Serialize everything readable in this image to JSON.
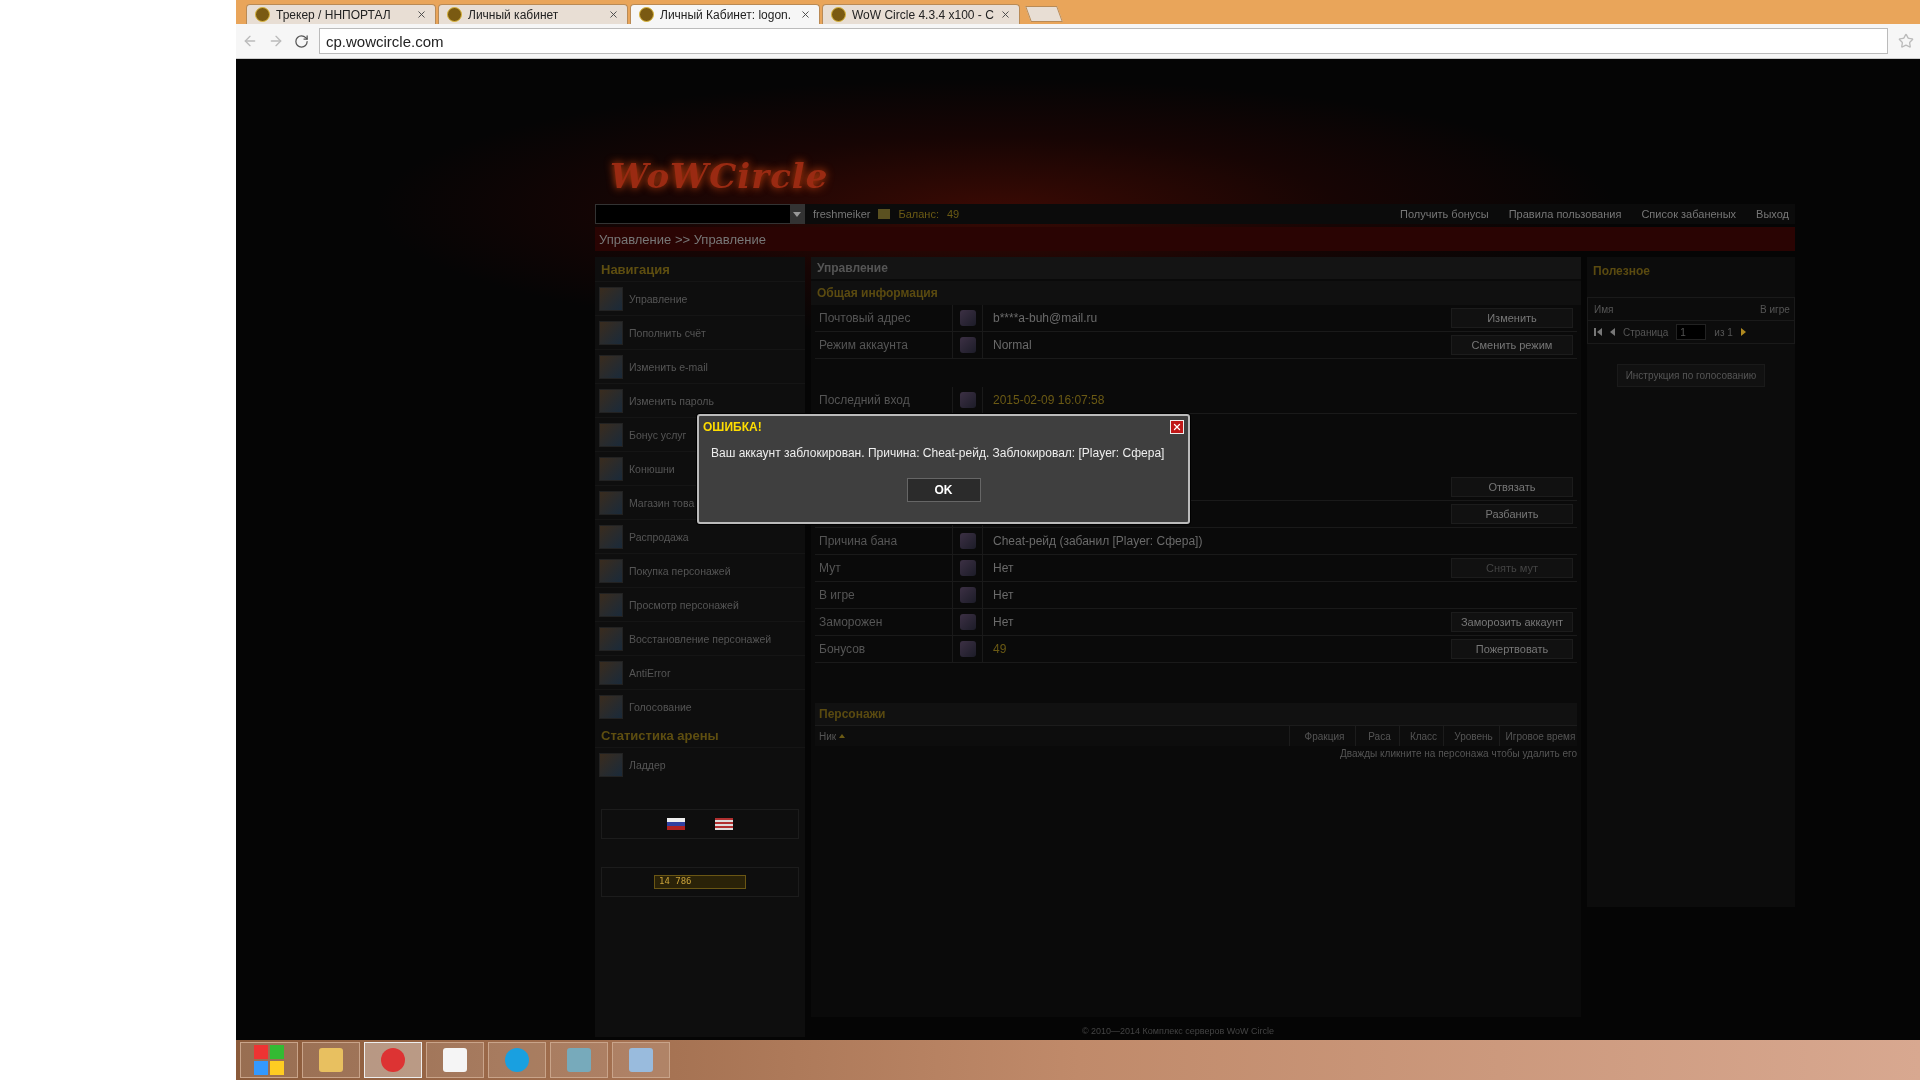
{
  "browser": {
    "tabs": [
      {
        "title": "Трекер / ННПОРТАЛ",
        "selected": false
      },
      {
        "title": "Личный кабинет",
        "selected": false
      },
      {
        "title": "Личный Кабинет: logon.",
        "selected": true
      },
      {
        "title": "WoW Circle 4.3.4 x100 - C",
        "selected": false
      }
    ],
    "address": "cp.wowcircle.com"
  },
  "logo": "WoWCircle",
  "topbar": {
    "username": "freshmeiker",
    "balance_label": "Баланс:",
    "balance": "49",
    "links": [
      "Получить бонусы",
      "Правила пользования",
      "Список забаненых",
      "Выход"
    ]
  },
  "breadcrumb": "Управление >> Управление",
  "navigation": {
    "title": "Навигация",
    "items": [
      "Управление",
      "Пополнить счёт",
      "Изменить e-mail",
      "Изменить пароль",
      "Бонус услуг",
      "Конюшни",
      "Магазин това",
      "Распродажа",
      "Покупка персонажей",
      "Просмотр персонажей",
      "Восстановление персонажей",
      "AntiError",
      "Голосование"
    ],
    "arena_title": "Статистика арены",
    "arena_items": [
      "Ладдер"
    ],
    "counter": "14 786"
  },
  "main": {
    "title": "Управление",
    "section": "Общая информация",
    "groups": [
      [
        {
          "label": "Почтовый адрес",
          "value": "b****a-buh@mail.ru",
          "highlight": false,
          "button": "Изменить",
          "disabled": false
        },
        {
          "label": "Режим аккаунта",
          "value": "Normal",
          "highlight": false,
          "button": "Сменить режим",
          "disabled": false
        }
      ],
      [
        {
          "label": "Последний вход",
          "value": "2015-02-09 16:07:58",
          "highlight": true
        }
      ],
      [
        {
          "button": "Отвязать",
          "disabled": false
        },
        {
          "button": "Разбанить",
          "disabled": false
        },
        {
          "label": "Причина бана",
          "value": "Cheat-рейд (забанил [Player: Сфера])",
          "highlight": false
        },
        {
          "label": "Мут",
          "value": "Нет",
          "highlight": false,
          "button": "Снять мут",
          "disabled": true
        },
        {
          "label": "В игре",
          "value": "Нет",
          "highlight": false
        },
        {
          "label": "Заморожен",
          "value": "Нет",
          "highlight": false,
          "button": "Заморозить аккаунт",
          "disabled": false
        },
        {
          "label": "Бонусов",
          "value": "49",
          "highlight": true,
          "button": "Пожертвовать",
          "disabled": false
        }
      ]
    ],
    "characters": {
      "title": "Персонажи",
      "columns": [
        {
          "label": "Ник",
          "sorted": true
        },
        {
          "label": "Фракция",
          "sorted": false
        },
        {
          "label": "Раса",
          "sorted": false
        },
        {
          "label": "Класс",
          "sorted": false
        },
        {
          "label": "Уровень",
          "sorted": false
        },
        {
          "label": "Игровое время",
          "sorted": false
        }
      ],
      "hint": "Дважды кликните на персонажа чтобы удалить его"
    }
  },
  "useful": {
    "title": "Полезное",
    "columns": [
      "Имя",
      "В игре"
    ],
    "page_label": "Страница",
    "page": "1",
    "page_of": "из 1",
    "vote_button": "Инструкция по голосованию"
  },
  "footer": "© 2010—2014 Комплекс серверов WoW Circle",
  "dialog": {
    "title": "ОШИБКА!",
    "message": "Ваш аккаунт заблокирован. Причина: Cheat-рейд. Заблокировал: [Player: Сфера]",
    "ok": "OK"
  }
}
